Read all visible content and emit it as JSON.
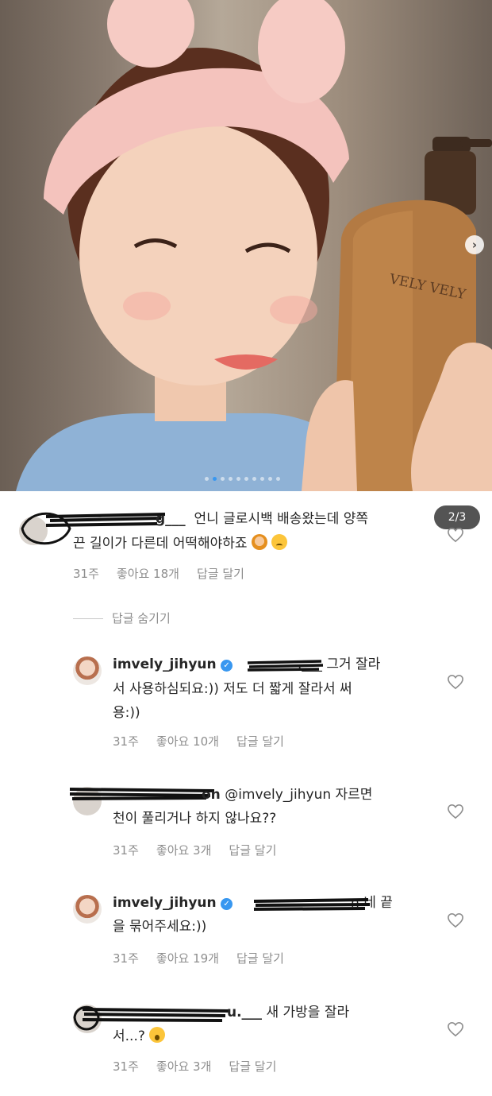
{
  "post": {
    "product_text": "VELY VELY",
    "page_indicator": "2/3",
    "dots_count": 10,
    "active_dot": 1
  },
  "colors": {
    "link_blue": "#3897f0",
    "meta_gray": "#8e8e8e",
    "text": "#262626"
  },
  "icons": {
    "heart": "heart-outline-icon",
    "verified": "verified-badge-icon",
    "next": "chevron-right-icon"
  },
  "comments": [
    {
      "user_partial": "g___",
      "text": "언니 글로시백 배송왔는데 양쪽",
      "text2": "끈 길이가 다른데 어떡해야하죠",
      "time": "31주",
      "likes": "좋아요 18개",
      "reply": "답글 달기"
    },
    {
      "hide_replies": "답글 숨기기"
    },
    {
      "user": "imvely_jihyun",
      "mention_partial": ".___",
      "text1": "그거 잘라",
      "text2": "서 사용하심되요:)) 저도 더 짧게 잘라서 써",
      "text3": "용:))",
      "time": "31주",
      "likes": "좋아요 10개",
      "reply": "답글 달기"
    },
    {
      "user_partial": "on",
      "mention": "@imvely_jihyun",
      "text1": "자르면",
      "text2": "천이 풀리거나 하지 않나요??",
      "time": "31주",
      "likes": "좋아요 3개",
      "reply": "답글 달기"
    },
    {
      "user": "imvely_jihyun",
      "mention_partial": "n",
      "text1": "네 끝",
      "text2": "을 묶어주세요:))",
      "time": "31주",
      "likes": "좋아요 19개",
      "reply": "답글 달기"
    },
    {
      "user_partial": "u.___",
      "text1": "새 가방을 잘라",
      "text2": "서...?",
      "time": "31주",
      "likes": "좋아요 3개",
      "reply": "답글 달기"
    }
  ]
}
